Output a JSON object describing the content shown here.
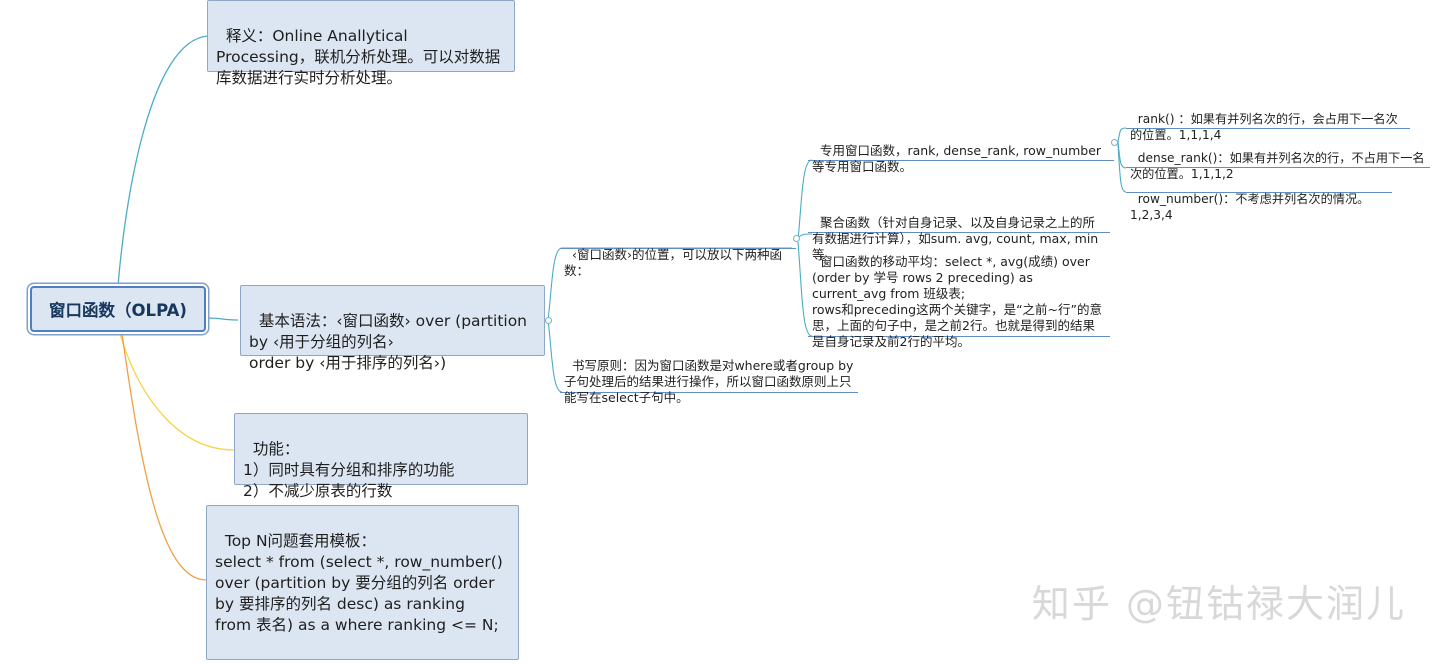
{
  "root": {
    "label": "窗口函数（OLPA)"
  },
  "definition": {
    "text": "释义：Online Anallytical Processing，联机分析处理。可以对数据库数据进行实时分析处理。"
  },
  "syntax": {
    "text": "基本语法：‹窗口函数› over (partition by ‹用于分组的列名›\norder by ‹用于排序的列名›)"
  },
  "position_topic": {
    "text": "‹窗口函数›的位置，可以放以下两种函数："
  },
  "special_funcs": {
    "text": "专用窗口函数，rank, dense_rank, row_number等专用窗口函数。"
  },
  "rank": {
    "text": "rank() ：如果有并列名次的行，会占用下一名次的位置。1,1,1,4"
  },
  "dense_rank": {
    "text": "dense_rank()：如果有并列名次的行，不占用下一名次的位置。1,1,1,2"
  },
  "row_number": {
    "text": "row_number()：不考虑并列名次的情况。1,2,3,4"
  },
  "aggregate": {
    "text": "聚合函数（针对自身记录、以及自身记录之上的所有数据进行计算），如sum. avg, count, max, min等"
  },
  "moving_avg": {
    "text": "窗口函数的移动平均：select *, avg(成绩) over (order by 学号 rows 2 preceding) as current_avg from 班级表;\nrows和preceding这两个关键字，是“之前~行”的意思，上面的句子中，是之前2行。也就是得到的结果是自身记录及前2行的平均。"
  },
  "writing_rule": {
    "text": "书写原则：因为窗口函数是对where或者group by子句处理后的结果进行操作，所以窗口函数原则上只能写在select子句中。"
  },
  "function": {
    "text": "功能：\n1）同时具有分组和排序的功能\n2）不减少原表的行数"
  },
  "topn": {
    "text": "Top N问题套用模板：\nselect * from (select *, row_number() over (partition by 要分组的列名 order by 要排序的列名 desc) as ranking  from 表名) as a where ranking <= N;"
  },
  "watermark": {
    "text": "知乎 @钮钴禄大润儿"
  },
  "colors": {
    "teal": "#4bacc6",
    "yellow": "#f5d547",
    "orange": "#f0a048",
    "box_fill": "#dce6f2",
    "box_border": "#8fa7c6",
    "link_blue": "#5f8fc5"
  }
}
